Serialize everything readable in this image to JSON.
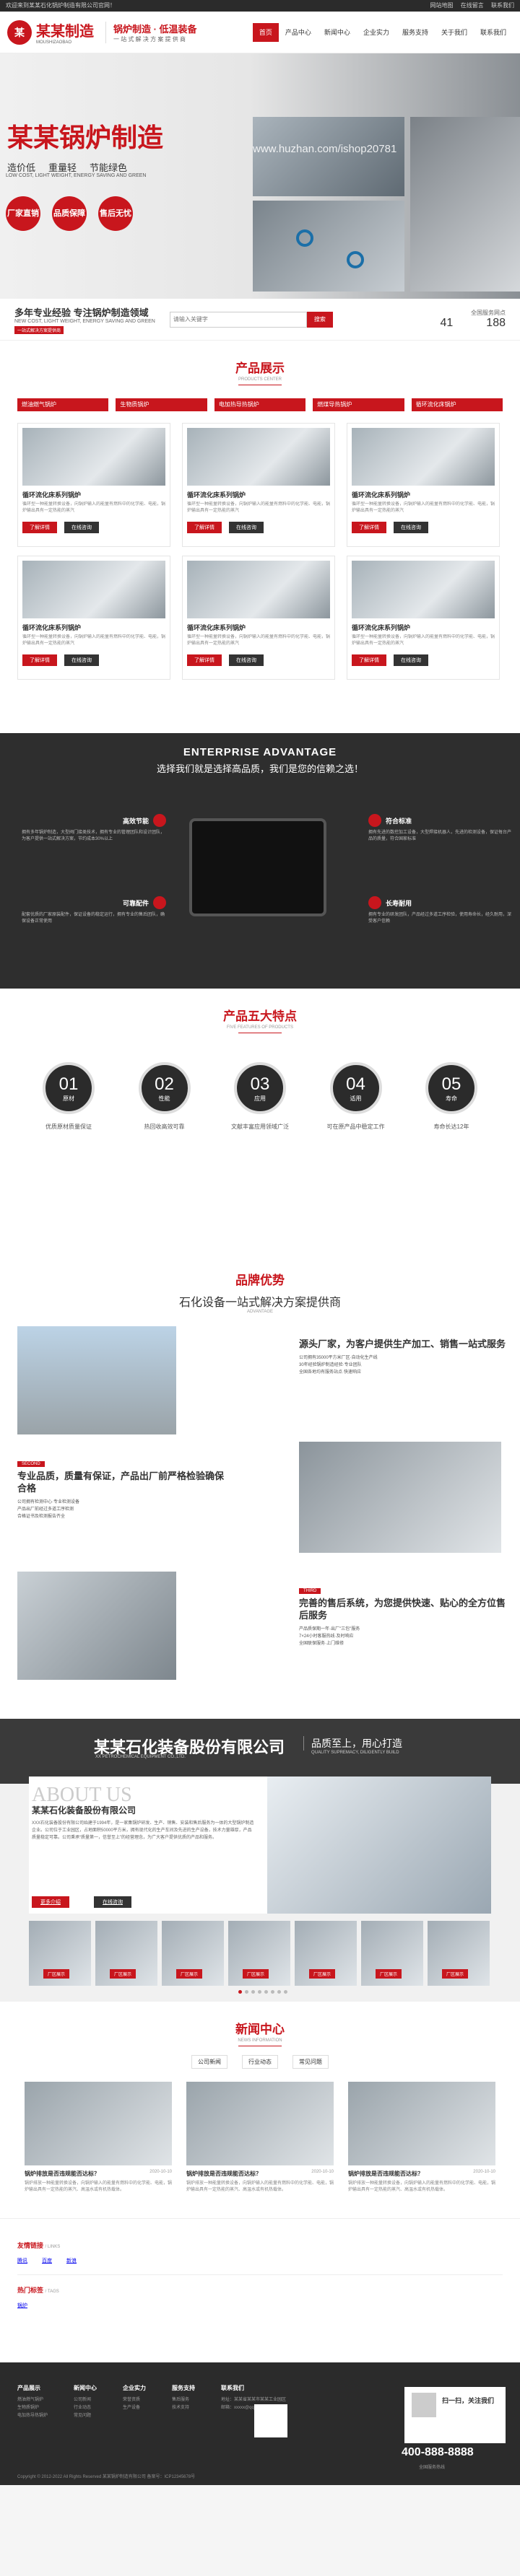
{
  "topbar": {
    "left": "欢迎来到某某石化锅炉制造有限公司官网！",
    "links": [
      "网站地图",
      "在线留言",
      "联系我们"
    ]
  },
  "header": {
    "logo_cn": "某某制造",
    "logo_en": "MOUSHIZAOBAO",
    "slogan_a": "锅炉制造 · 低温装备",
    "slogan_b": "一 站 式 解 决 方 案 提 供 商",
    "nav": [
      "首页",
      "产品中心",
      "新闻中心",
      "企业实力",
      "服务支持",
      "关于我们",
      "联系我们"
    ]
  },
  "banner": {
    "title": "某某锅炉制造",
    "features": [
      "造价低",
      "重量轻",
      "节能绿色"
    ],
    "features_en": "LOW COST, LIGHT WEIGHT, ENERGY SAVING AND GREEN",
    "circles": [
      "厂家直销",
      "品质保障",
      "售后无忧"
    ],
    "watermark": "www.huzhan.com/ishop20781"
  },
  "search": {
    "title": "多年专业经验 专注锅炉制造领域",
    "subtitle": "NEW COST, LIGHT WEIGHT, ENERGY SAVING AND GREEN",
    "tag": "一站式解决方案提供商",
    "placeholder": "请输入关键字",
    "button": "搜索",
    "stats_label": "全国服务网点",
    "stat1": "41",
    "stat2": "188"
  },
  "products": {
    "title": "产品展示",
    "title_en": "PRODUCTS CENTER",
    "categories": [
      "燃油燃气锅炉",
      "生物质锅炉",
      "电加热导热锅炉",
      "燃煤导热锅炉",
      "循环流化床锅炉"
    ],
    "items": [
      {
        "name": "循环流化床系列锅炉",
        "desc": "循环型一种能量转换设备，向锅炉输入的能量有燃料中的化学能、电能，锅炉输出具有一定热能的蒸汽"
      },
      {
        "name": "循环流化床系列锅炉",
        "desc": "循环型一种能量转换设备，向锅炉输入的能量有燃料中的化学能、电能，锅炉输出具有一定热能的蒸汽"
      },
      {
        "name": "循环流化床系列锅炉",
        "desc": "循环型一种能量转换设备，向锅炉输入的能量有燃料中的化学能、电能，锅炉输出具有一定热能的蒸汽"
      },
      {
        "name": "循环流化床系列锅炉",
        "desc": "循环型一种能量转换设备，向锅炉输入的能量有燃料中的化学能、电能，锅炉输出具有一定热能的蒸汽"
      },
      {
        "name": "循环流化床系列锅炉",
        "desc": "循环型一种能量转换设备，向锅炉输入的能量有燃料中的化学能、电能，锅炉输出具有一定热能的蒸汽"
      },
      {
        "name": "循环流化床系列锅炉",
        "desc": "循环型一种能量转换设备，向锅炉输入的能量有燃料中的化学能、电能，锅炉输出具有一定热能的蒸汽"
      }
    ],
    "btn_detail": "了解详情",
    "btn_consult": "在线咨询"
  },
  "advantage": {
    "title": "ENTERPRISE ADVANTAGE",
    "subtitle": "选择我们就是选择高品质，我们是您的信赖之选！",
    "items": [
      {
        "title": "高效节能",
        "text": "拥有多年锅炉制造，大型阀门接类技术，拥有专业的管理团队和设计团队，为客户提供一站式解决方案，节约成本30%以上"
      },
      {
        "title": "符合标准",
        "text": "拥有先进的数控加工设备，大型焊接机器人，先进的检测设备，保证每台产品的质量，符合国家标准"
      },
      {
        "title": "可靠配件",
        "text": "配套优质的厂家原装配件，保证设备的稳定运行，拥有专业的售后团队，确保设备正常使用"
      },
      {
        "title": "长寿耐用",
        "text": "拥有专业的研发团队，产品经过多道工序检验，使用寿命长，经久耐用，深受客户信赖"
      }
    ]
  },
  "five": {
    "title": "产品五大特点",
    "title_en": "FIVE FEATURES OF PRODUCTS",
    "items": [
      {
        "n": "01",
        "l": "原材",
        "cap": "优质原材质量保证"
      },
      {
        "n": "02",
        "l": "性能",
        "cap": "热回收高效可靠"
      },
      {
        "n": "03",
        "l": "应用",
        "cap": "文献丰富应用领域广泛"
      },
      {
        "n": "04",
        "l": "适用",
        "cap": "可在原产品中稳定工作"
      },
      {
        "n": "05",
        "l": "寿命",
        "cap": "寿命长达12年"
      }
    ]
  },
  "brand": {
    "title": "品牌优势",
    "subtitle": "石化设备一站式解决方案提供商",
    "subtitle_en": "ADVANTAGE",
    "b1": {
      "title": "源头厂家，为客户提供生产加工、销售一站式服务",
      "points": "公司拥有35000平方米厂区·自动化生产线\n30年经验锅炉制造经验·专业团队\n全国各地均有服务站点·快速响应"
    },
    "b2": {
      "tag": "SECOND",
      "title": "专业品质，质量有保证，产品出厂前严格检验确保合格",
      "points": "公司拥有检测中心·专业检测设备\n产品出厂前经过多道工序检测\n合格证书及检测报告齐全"
    },
    "b3": {
      "tag": "THIRD",
      "title": "完善的售后系统，为您提供快速、贴心的全方位售后服务",
      "points": "产品质保期一年·出厂\"三包\"服务\n7×24小时客服热线·及时响应\n全国联保服务·上门维修"
    }
  },
  "about": {
    "title": "某某石化装备股份有限公司",
    "title_en": "XX PETROCHEMICAL EQUIPMENT CO.,LTD.",
    "motto": "品质至上，用心打造",
    "motto_en": "QUALITY SUPREMACY, DILIGENTLY BUILD",
    "heading": "ABOUT US",
    "cname": "某某石化装备股份有限公司",
    "text": "XXX石化装备股份有限公司始建于1994年，是一家集锅炉研发、生产、销售、安装和售后服务为一体的大型锅炉制造企业。公司位于工业园区，占地面积50000平方米，拥有现代化的生产车间及先进的生产设备，技术力量雄厚，产品质量稳定可靠。公司秉承“质量第一，信誉至上”的经营理念，为广大客户提供优质的产品和服务。",
    "btn1": "更多介绍",
    "btn2": "在线咨询",
    "thumbs": [
      "厂区展示",
      "厂区展示",
      "厂区展示",
      "厂区展示",
      "厂区展示",
      "厂区展示",
      "厂区展示"
    ]
  },
  "news": {
    "title": "新闻中心",
    "title_en": "NEWS INFORMATION",
    "tabs": [
      "公司新闻",
      "行业动态",
      "常见问题"
    ],
    "items": [
      {
        "t": "锅炉排放是否违规能否达标？",
        "d": "2020-10-10",
        "p": "锅炉排放一种能量转换设备，向锅炉输入的能量有燃料中的化学能、电能，锅炉输出具有一定热能的蒸汽、高温水或有机热载体。"
      },
      {
        "t": "锅炉排放是否违规能否达标？",
        "d": "2020-10-10",
        "p": "锅炉排放一种能量转换设备，向锅炉输入的能量有燃料中的化学能、电能，锅炉输出具有一定热能的蒸汽、高温水或有机热载体。"
      },
      {
        "t": "锅炉排放是否违规能否达标？",
        "d": "2020-10-10",
        "p": "锅炉排放一种能量转换设备，向锅炉输入的能量有燃料中的化学能、电能，锅炉输出具有一定热能的蒸汽、高温水或有机热载体。"
      }
    ]
  },
  "links": {
    "title1": "友情链接",
    "title1_en": "/ LINKS",
    "items": [
      "腾讯",
      "百度",
      "新浪"
    ],
    "title2": "热门标签",
    "title2_en": "/ TAGS",
    "tags": [
      "锅炉"
    ]
  },
  "footer": {
    "cols": [
      {
        "h": "产品展示",
        "items": [
          "燃油燃气锅炉",
          "生物质锅炉",
          "电加热导热锅炉"
        ]
      },
      {
        "h": "新闻中心",
        "items": [
          "公司新闻",
          "行业动态",
          "常见问题"
        ]
      },
      {
        "h": "企业实力",
        "items": [
          "荣誉资质",
          "生产设备"
        ]
      },
      {
        "h": "服务支持",
        "items": [
          "售后服务",
          "技术支持"
        ]
      },
      {
        "h": "联系我们",
        "items": [
          "地址：某某省某某市某某工业园区",
          "邮箱：xxxxx@qq.com"
        ]
      }
    ],
    "qr": "扫一扫，关注我们",
    "tel": "400-888-8888",
    "tel_sub": "全国服务热线",
    "copy": "Copyright © 2012-2022 All Rights Reserved 某某锅炉制造有限公司 备案号：ICP12345678号"
  }
}
